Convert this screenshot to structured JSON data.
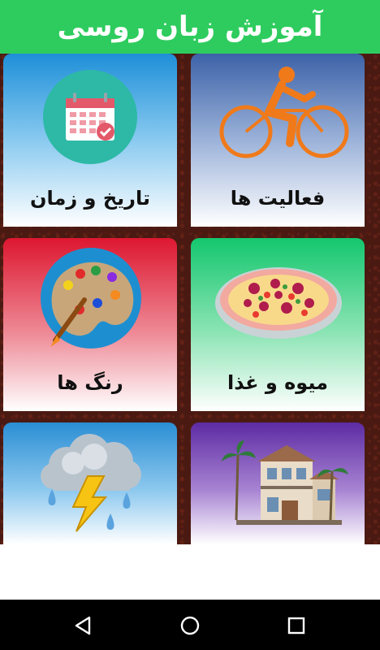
{
  "header": {
    "title": "آموزش زبان روسی"
  },
  "categories": [
    {
      "label": "تاریخ و زمان",
      "icon": "calendar-icon"
    },
    {
      "label": "فعالیت ها",
      "icon": "bicycle-icon"
    },
    {
      "label": "رنگ ها",
      "icon": "palette-icon"
    },
    {
      "label": "میوه و غذا",
      "icon": "pizza-icon"
    },
    {
      "label": "",
      "icon": "weather-storm-icon"
    },
    {
      "label": "",
      "icon": "house-icon"
    }
  ],
  "navbar": {
    "buttons": [
      "back-icon",
      "home-icon",
      "recents-icon"
    ]
  }
}
